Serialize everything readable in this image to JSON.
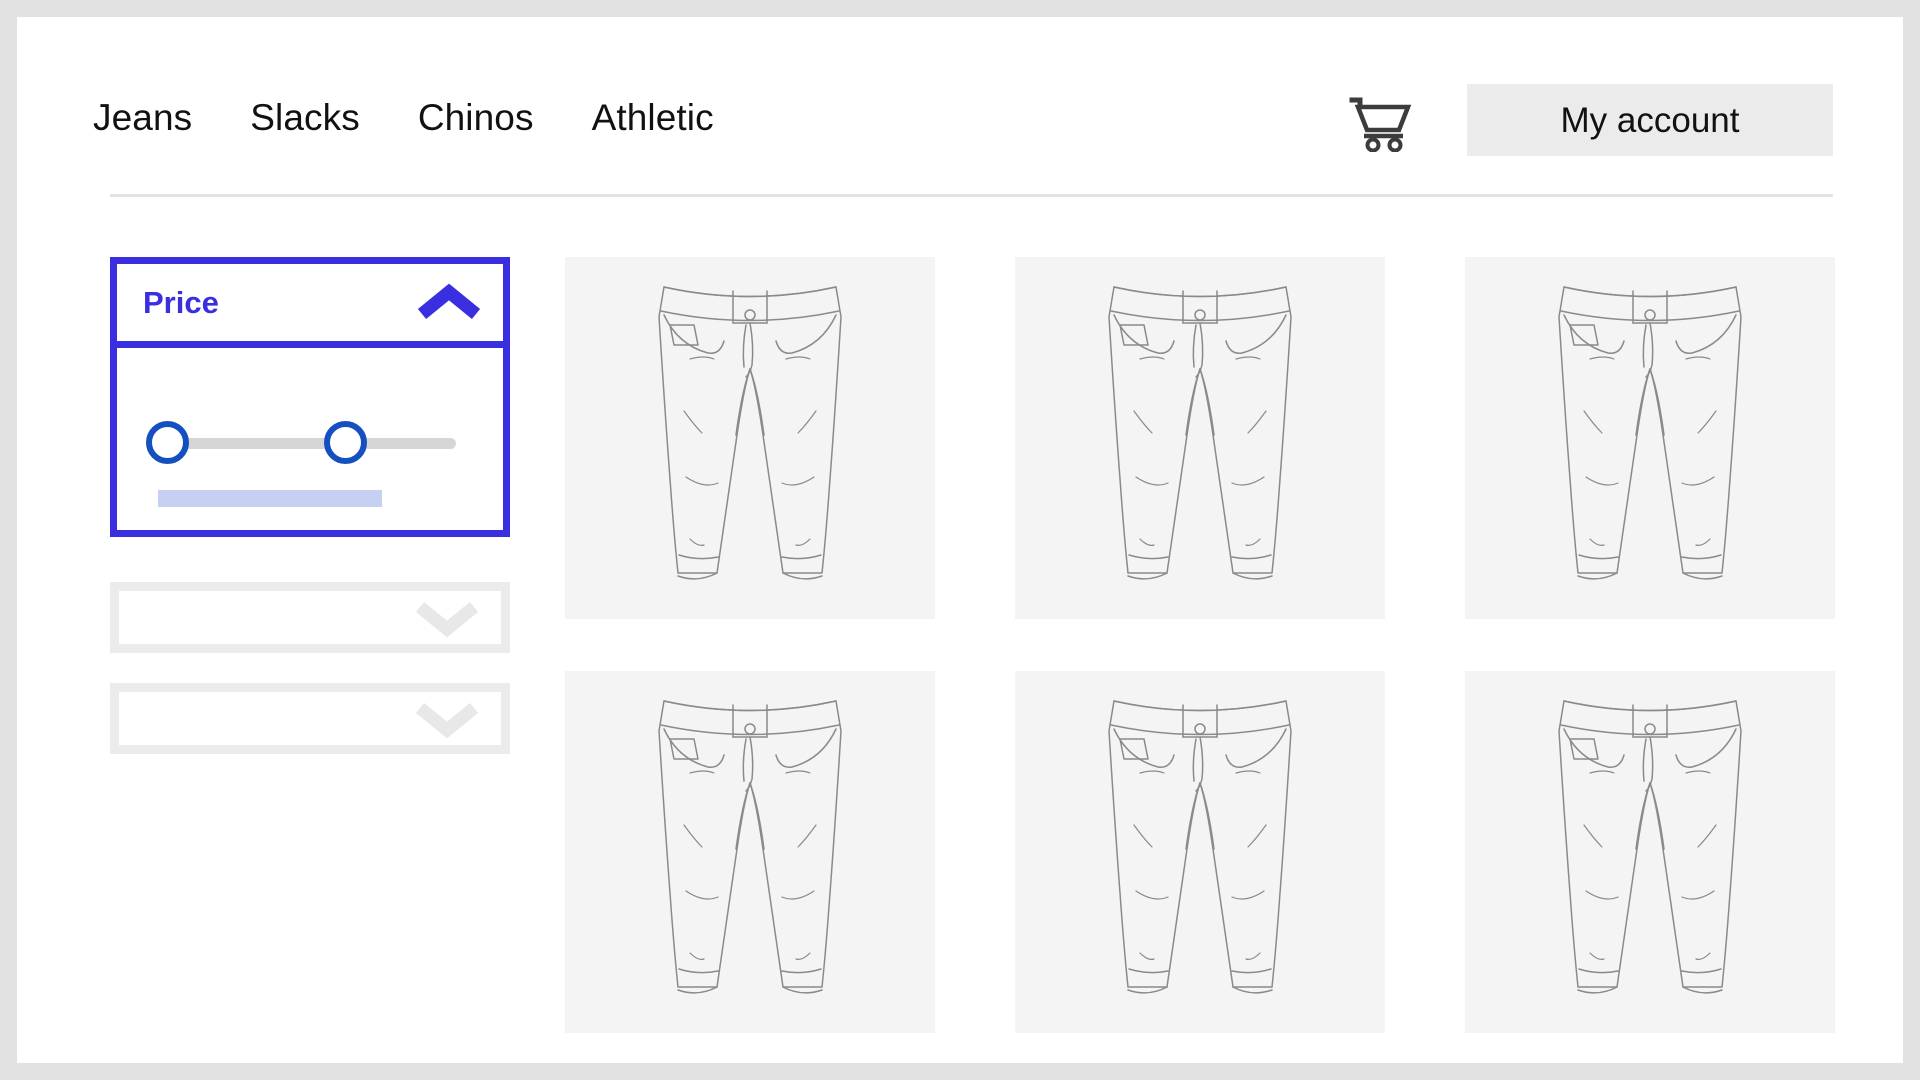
{
  "header": {
    "nav_items": [
      {
        "label": "Jeans"
      },
      {
        "label": "Slacks"
      },
      {
        "label": "Chinos"
      },
      {
        "label": "Athletic"
      }
    ],
    "cart_icon": "shopping-cart-icon",
    "account_button_label": "My account"
  },
  "sidebar": {
    "price_filter": {
      "title": "Price",
      "expanded": true,
      "chevron_icon": "chevron-up-icon",
      "accent_color": "#3a2fe0",
      "slider": {
        "handle_color": "#1550c0",
        "track_color": "#d6d6d6",
        "min_handle_position_pct": 0,
        "max_handle_position_pct": 62
      },
      "value_bar_color": "#c6d0f2"
    },
    "collapsed_filters": [
      {
        "label": "",
        "chevron_icon": "chevron-down-icon"
      },
      {
        "label": "",
        "chevron_icon": "chevron-down-icon"
      }
    ]
  },
  "products": {
    "card_background": "#f4f4f4",
    "items": [
      {
        "image": "jeans-line-art"
      },
      {
        "image": "jeans-line-art"
      },
      {
        "image": "jeans-line-art"
      },
      {
        "image": "jeans-line-art"
      },
      {
        "image": "jeans-line-art"
      },
      {
        "image": "jeans-line-art"
      }
    ]
  }
}
